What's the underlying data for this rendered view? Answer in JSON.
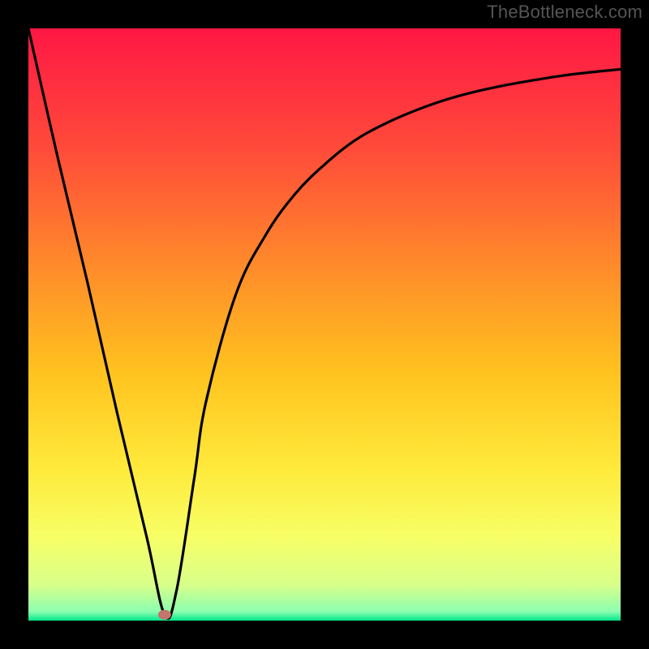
{
  "watermark": "TheBottleneck.com",
  "chart_data": {
    "type": "line",
    "title": "",
    "xlabel": "",
    "ylabel": "",
    "xlim": [
      0,
      100
    ],
    "ylim": [
      0,
      100
    ],
    "x": [
      0,
      5,
      10,
      15,
      20,
      23,
      25,
      28,
      30,
      35,
      40,
      45,
      50,
      55,
      60,
      65,
      70,
      75,
      80,
      85,
      90,
      95,
      100
    ],
    "series": [
      {
        "name": "bottleneck-curve",
        "values": [
          100,
          78,
          57,
          35,
          14,
          1,
          5,
          24,
          37,
          55,
          65,
          72,
          77,
          81,
          83.8,
          86,
          87.8,
          89.2,
          90.3,
          91.2,
          92,
          92.6,
          93.1
        ]
      }
    ],
    "marker": {
      "x": 23,
      "y": 1
    },
    "gradient_stops": [
      {
        "offset": 0.0,
        "color": "#ff1744"
      },
      {
        "offset": 0.2,
        "color": "#ff4a3a"
      },
      {
        "offset": 0.4,
        "color": "#ff8a2a"
      },
      {
        "offset": 0.58,
        "color": "#ffc21f"
      },
      {
        "offset": 0.74,
        "color": "#ffe93a"
      },
      {
        "offset": 0.86,
        "color": "#f7ff66"
      },
      {
        "offset": 0.94,
        "color": "#d8ff8a"
      },
      {
        "offset": 0.985,
        "color": "#8bffb0"
      },
      {
        "offset": 1.0,
        "color": "#00e58a"
      }
    ]
  }
}
